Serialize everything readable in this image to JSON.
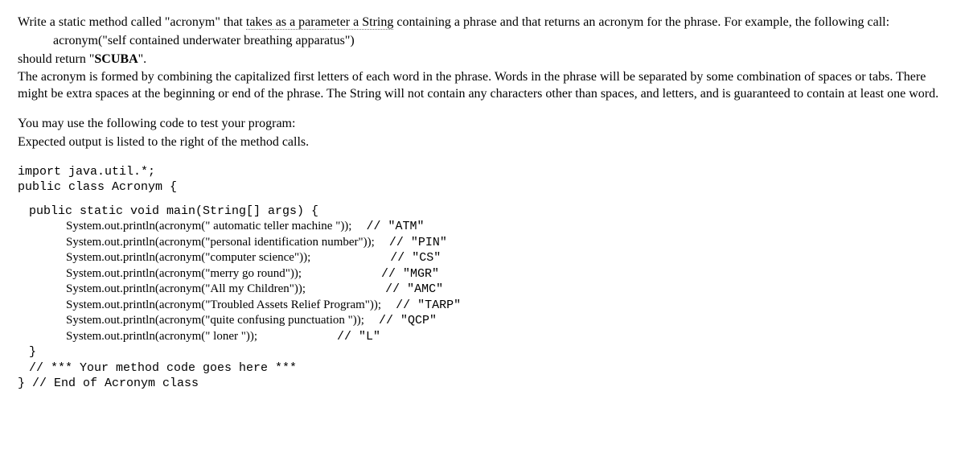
{
  "prose": {
    "p1a": "Write a static method called \"acronym\" that ",
    "p1b_dotted": "takes as a parameter a String",
    "p1c": " containing a phrase and that returns an acronym for the phrase.  For example, the following call:",
    "p2": "acronym(\"self contained underwater breathing apparatus\")",
    "p3a": "should return \"",
    "p3b_bold": "SCUBA",
    "p3c": "\".",
    "p4": "The acronym is formed by combining the capitalized first letters of each word in the phrase.  Words in the phrase will be separated by some combination of spaces or tabs.  There might be extra spaces at the beginning or end of the phrase.  The String will not contain any characters other than spaces, and letters, and is guaranteed to contain at least one word.",
    "p5": "You may use the following code to test your program:",
    "p6": " Expected output is listed to the right of the method calls."
  },
  "code": {
    "l01": "import java.util.*;",
    "l02": "public class Acronym {",
    "l03": "public static void main(String[] args) {",
    "l04a": "System.out.println(acronym(\" automatic  teller   machine  \"));",
    "l04b": "  // \"ATM\"",
    "l05a": "System.out.println(acronym(\"personal identification number\"));",
    "l05b": "  // \"PIN\"",
    "l06a": "System.out.println(acronym(\"computer  science\"));",
    "l06b": "           // \"CS\"",
    "l07a": "System.out.println(acronym(\"merry  go  round\"));",
    "l07b": "           // \"MGR\"",
    "l08a": "System.out.println(acronym(\"All  my  Children\"));",
    "l08b": "           // \"AMC\"",
    "l09a": "System.out.println(acronym(\"Troubled Assets Relief Program\"));",
    "l09b": "  // \"TARP\"",
    "l10a": "System.out.println(acronym(\"quite  confusing  punctuation \"));",
    "l10b": "  // \"QCP\"",
    "l11a": "System.out.println(acronym(\"  loner  \"));",
    "l11b": "           // \"L\"",
    "l12": "}",
    "l13": "  // *** Your method code goes here ***",
    "l14": "} // End of Acronym class"
  }
}
